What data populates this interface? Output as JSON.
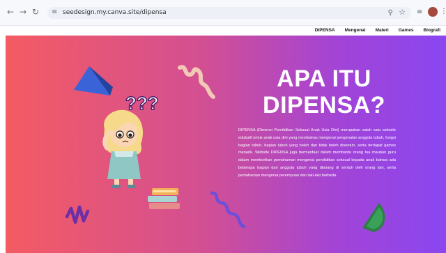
{
  "browser": {
    "url": "seedesign.my.canva.site/dipensa",
    "back_icon": "arrow-left-icon",
    "forward_icon": "arrow-right-icon",
    "reload_icon": "reload-icon"
  },
  "site_nav": {
    "items": [
      "DIPENSA",
      "Mengenai",
      "Materi",
      "Games",
      "Biografi"
    ]
  },
  "hero": {
    "title_line1": "APA ITU",
    "title_line2": "DIPENSA?",
    "body": "DIPENSA (Dimensi Pendidikan Seksual Anak Usia Dini) merupakan salah satu website edukatif untuk anak usia dini yang membahas mengenai pengenalan anggota tubuh, fungsi bagian tubuh, bagian tubuh yang boleh dan tidak boleh disentuh, serta terdapat games menarik. Website DIPENSA juga bermanfaat dalam membantu orang tua maupun guru dalam memberikan pemahaman mengenai pendidikan seksual kepada anak bahwa ada beberapa bagian dari anggota tubuh yang dilarang di sentuh oleh orang lain, serta pemahaman mengenai perempuan dan laki-laki berbeda."
  },
  "colors": {
    "gradient_start": "#f45b62",
    "gradient_end": "#8a46f0"
  }
}
